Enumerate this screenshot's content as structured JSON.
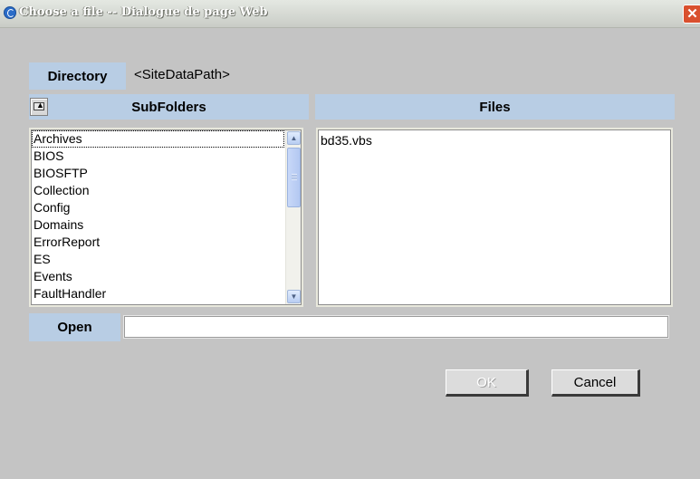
{
  "window": {
    "title": "Choose a file -- Dialogue de page Web",
    "close_glyph": "✕"
  },
  "directory": {
    "label": "Directory",
    "value": "<SiteDataPath>"
  },
  "subfolders": {
    "header": "SubFolders",
    "up_icon": "folder-up-icon",
    "items": [
      "Archives",
      "BIOS",
      "BIOSFTP",
      "Collection",
      "Config",
      "Domains",
      "ErrorReport",
      "ES",
      "Events",
      "FaultHandler"
    ],
    "focused_item": "Archives"
  },
  "files": {
    "header": "Files",
    "items": [
      "bd35.vbs"
    ]
  },
  "open": {
    "label": "Open",
    "value": "",
    "placeholder": ""
  },
  "buttons": {
    "ok_label": "OK",
    "cancel_label": "Cancel"
  },
  "colors": {
    "dialog_background": "#c4c4c4",
    "label_background": "#b8cde4",
    "close_button": "#d9502e"
  }
}
